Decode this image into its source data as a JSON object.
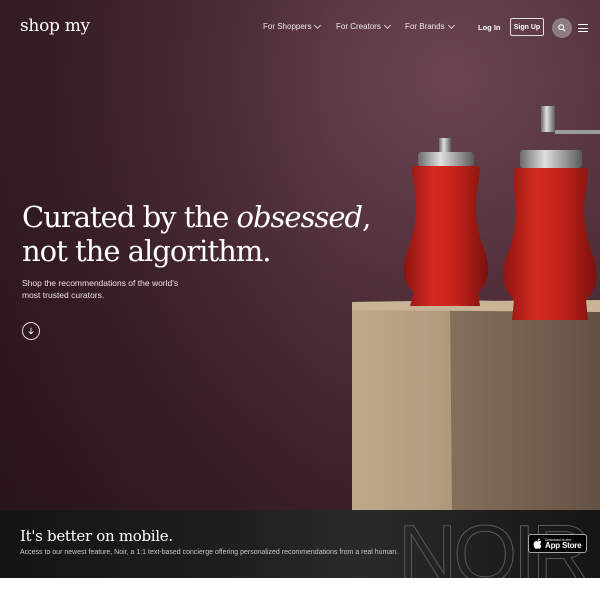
{
  "brand": {
    "logo": "shop my"
  },
  "nav": {
    "items": [
      {
        "label": "For Shoppers"
      },
      {
        "label": "For Creators"
      },
      {
        "label": "For Brands"
      }
    ],
    "login": "Log In",
    "signup": "Sign Up",
    "icons": {
      "search": "search-icon",
      "menu": "hamburger-menu-icon",
      "chevron": "chevron-down-icon"
    }
  },
  "hero": {
    "headline_part1": "Curated by the ",
    "headline_emphasis": "obsessed",
    "headline_part2": ",",
    "headline_line2": "not the algorithm.",
    "subtext": "Shop the recommendations of the world's most trusted curators.",
    "scroll_icon": "arrow-down-circle-icon"
  },
  "banner": {
    "title": "It's better on mobile.",
    "subtitle": "Access to our newest feature, Noir, a 1:1 text-based concierge offering personalized recommendations from a real human.",
    "watermark": "NOIR",
    "app_store": {
      "line1": "Download on the",
      "line2": "App Store",
      "icon": "apple-icon"
    }
  },
  "colors": {
    "hero_bg": "#4a2c37",
    "pepper_red": "#c8231a",
    "banner_bg": "#1a1a1a"
  }
}
